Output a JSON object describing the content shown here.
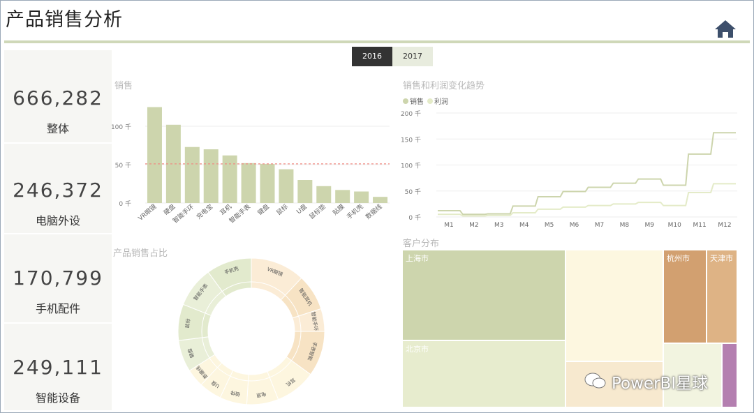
{
  "header": {
    "title": "产品销售分析",
    "home_icon": "home-icon"
  },
  "slicer": {
    "options": [
      "2016",
      "2017"
    ],
    "selected": "2016"
  },
  "kpis": [
    {
      "value": "666,282",
      "label": "整体"
    },
    {
      "value": "246,372",
      "label": "电脑外设"
    },
    {
      "value": "170,799",
      "label": "手机配件"
    },
    {
      "value": "249,111",
      "label": "智能设备"
    }
  ],
  "watermark": "PowerBI星球",
  "colors": {
    "accent": "#cdd5ad",
    "line_profit": "#e4ebc8",
    "avg_line": "#f08c84",
    "pink": "#b47fb0"
  },
  "chart_data": [
    {
      "type": "bar",
      "title": "销售",
      "categories": [
        "VR眼镜",
        "硬盘",
        "智能手环",
        "充电宝",
        "耳机",
        "智能手表",
        "键盘",
        "鼠标",
        "U盘",
        "鼠标垫",
        "贴膜",
        "手机壳",
        "数据线"
      ],
      "values": [
        125,
        102,
        73,
        70,
        62,
        52,
        51,
        44,
        30,
        22,
        17,
        15,
        8
      ],
      "y_ticks": [
        "0 千",
        "50 千",
        "100 千"
      ],
      "ylim": [
        0,
        130
      ],
      "reference_line": 51
    },
    {
      "type": "line",
      "title": "销售和利润变化趋势",
      "legend": [
        "销售",
        "利润"
      ],
      "categories": [
        "M1",
        "M2",
        "M3",
        "M4",
        "M5",
        "M6",
        "M7",
        "M8",
        "M9",
        "M10",
        "M11",
        "M12"
      ],
      "series": [
        {
          "name": "销售",
          "values": [
            12,
            5,
            6,
            21,
            39,
            49,
            57,
            65,
            73,
            61,
            121,
            162
          ]
        },
        {
          "name": "利润",
          "values": [
            5,
            2,
            3,
            8,
            15,
            19,
            22,
            25,
            28,
            22,
            47,
            64
          ]
        }
      ],
      "y_ticks": [
        "0 千",
        "50 千",
        "100 千",
        "150 千",
        "200 千"
      ],
      "ylim": [
        0,
        200
      ]
    },
    {
      "type": "pie",
      "title": "产品销售占比",
      "labels": [
        "VR眼镜",
        "智能耳机",
        "智能手环",
        "手表智能",
        "耳机",
        "电源",
        "插排",
        "U盘",
        "数据线",
        "键盘",
        "鼠标",
        "智能手表",
        "手机壳"
      ],
      "values": [
        12,
        8,
        5,
        10,
        9,
        7,
        6,
        5,
        4,
        7,
        8,
        9,
        10
      ]
    },
    {
      "type": "treemap",
      "title": "客户分布",
      "labels": [
        "上海市",
        "北京市",
        "杭州市",
        "天津市",
        "",
        "",
        "",
        ""
      ],
      "values": [
        30,
        14,
        6,
        5,
        20,
        10,
        6,
        2
      ]
    }
  ]
}
